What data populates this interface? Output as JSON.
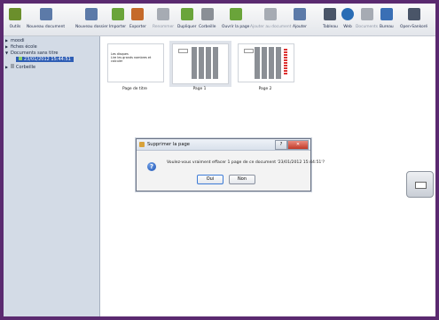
{
  "toolbar": {
    "items": [
      {
        "label": "Outils",
        "icon": "tools-icon",
        "color": "#6b8f2c",
        "enabled": true
      },
      {
        "label": "Nouveau document",
        "icon": "new-document-icon",
        "color": "#5c7aa8",
        "enabled": true
      },
      {
        "label": "Nouveau dossier",
        "icon": "new-folder-icon",
        "color": "#5c7aa8",
        "enabled": true
      },
      {
        "label": "Importer",
        "icon": "import-icon",
        "color": "#6aa43a",
        "enabled": true
      },
      {
        "label": "Exporter",
        "icon": "export-icon",
        "color": "#c56a2a",
        "enabled": true
      },
      {
        "label": "Renommer",
        "icon": "rename-icon",
        "color": "#a6abb3",
        "enabled": false
      },
      {
        "label": "Dupliquer",
        "icon": "duplicate-icon",
        "color": "#6aa43a",
        "enabled": true
      },
      {
        "label": "Corbeille",
        "icon": "trash-icon",
        "color": "#8a8f96",
        "enabled": true
      },
      {
        "label": "Ouvrir la page",
        "icon": "open-page-icon",
        "color": "#6aa43a",
        "enabled": true
      },
      {
        "label": "Ajouter au document",
        "icon": "add-to-document-icon",
        "color": "#a6abb3",
        "enabled": false
      },
      {
        "label": "Ajouter",
        "icon": "add-icon",
        "color": "#5c7aa8",
        "enabled": true
      },
      {
        "label": "Tableau",
        "icon": "board-icon",
        "color": "#4a5568",
        "enabled": true
      },
      {
        "label": "Web",
        "icon": "web-icon",
        "color": "#2a6db5",
        "enabled": true
      },
      {
        "label": "Documents",
        "icon": "documents-icon",
        "color": "#a6abb3",
        "enabled": false
      },
      {
        "label": "Bureau",
        "icon": "desktop-icon",
        "color": "#3a6fb5",
        "enabled": true
      },
      {
        "label": "Open-Sankoré",
        "icon": "open-sankore-icon",
        "color": "#4a5568",
        "enabled": true
      }
    ]
  },
  "sidebar": {
    "items": [
      {
        "label": "moodi",
        "expanded": false
      },
      {
        "label": "fiches école",
        "expanded": false
      },
      {
        "label": "Documents sans titre",
        "expanded": true
      },
      {
        "label": "23/01/2012 15:44:51",
        "selected": true
      },
      {
        "label": "Corbeille",
        "expanded": false
      }
    ]
  },
  "thumbnails": [
    {
      "caption": "Page de titre",
      "title_lines": [
        "Les disques",
        "Lire les grands nombres et calculer"
      ]
    },
    {
      "caption": "Page 1"
    },
    {
      "caption": "Page 2"
    }
  ],
  "dialog": {
    "title": "Supprimer la page",
    "message": "Voulez-vous vraiment effacer 1 page de ce document '23/01/2012 15:44:51'?",
    "ok_label": "Oui",
    "cancel_label": "Non"
  },
  "colors": {
    "accent": "#2f5eb5",
    "frame": "#5b2a70"
  }
}
